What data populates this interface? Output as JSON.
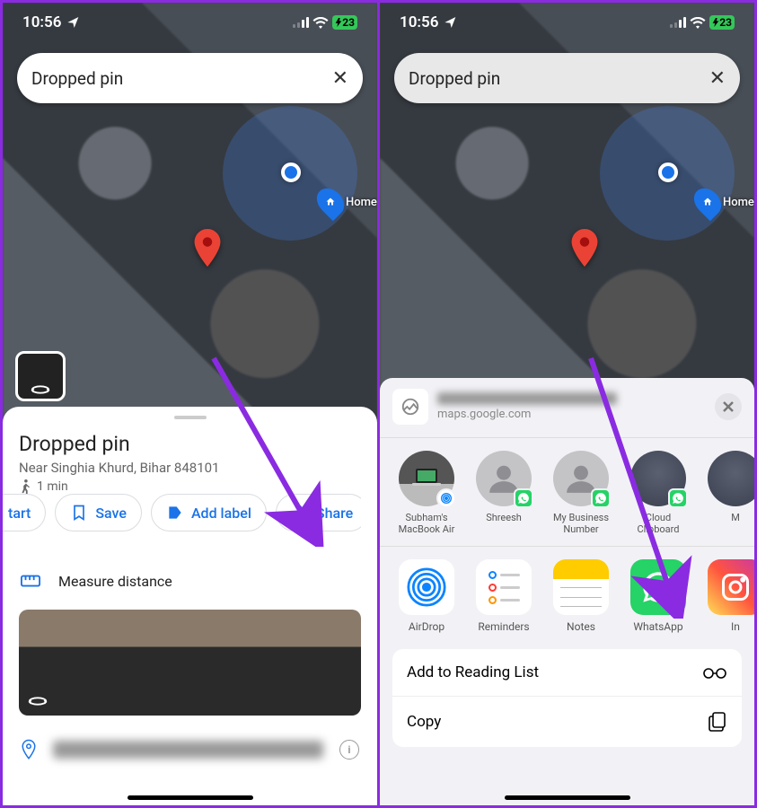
{
  "status": {
    "time": "10:56",
    "battery": "23"
  },
  "search": {
    "text": "Dropped pin"
  },
  "home_label": "Home",
  "left": {
    "title": "Dropped pin",
    "subtitle": "Near Singhia Khurd, Bihar 848101",
    "walk": "1 min",
    "chips": {
      "start": "tart",
      "save": "Save",
      "add_label": "Add label",
      "share": "Share"
    },
    "measure": "Measure distance"
  },
  "share": {
    "site": "maps.google.com",
    "contacts": [
      {
        "name": "Subham's MacBook Air",
        "type": "macbook",
        "badge": "airdrop"
      },
      {
        "name": "Shreesh",
        "type": "silhouette",
        "badge": "wa"
      },
      {
        "name": "My Business Number",
        "type": "silhouette",
        "badge": "wa"
      },
      {
        "name": "Cloud Clipboard",
        "type": "photo",
        "badge": "wa"
      },
      {
        "name": "M",
        "type": "photo",
        "badge": ""
      }
    ],
    "apps": [
      {
        "name": "AirDrop",
        "icon": "airdrop"
      },
      {
        "name": "Reminders",
        "icon": "reminders"
      },
      {
        "name": "Notes",
        "icon": "notes"
      },
      {
        "name": "WhatsApp",
        "icon": "whatsapp"
      },
      {
        "name": "In",
        "icon": "instagram"
      }
    ],
    "actions": {
      "reading_list": "Add to Reading List",
      "copy": "Copy"
    }
  }
}
